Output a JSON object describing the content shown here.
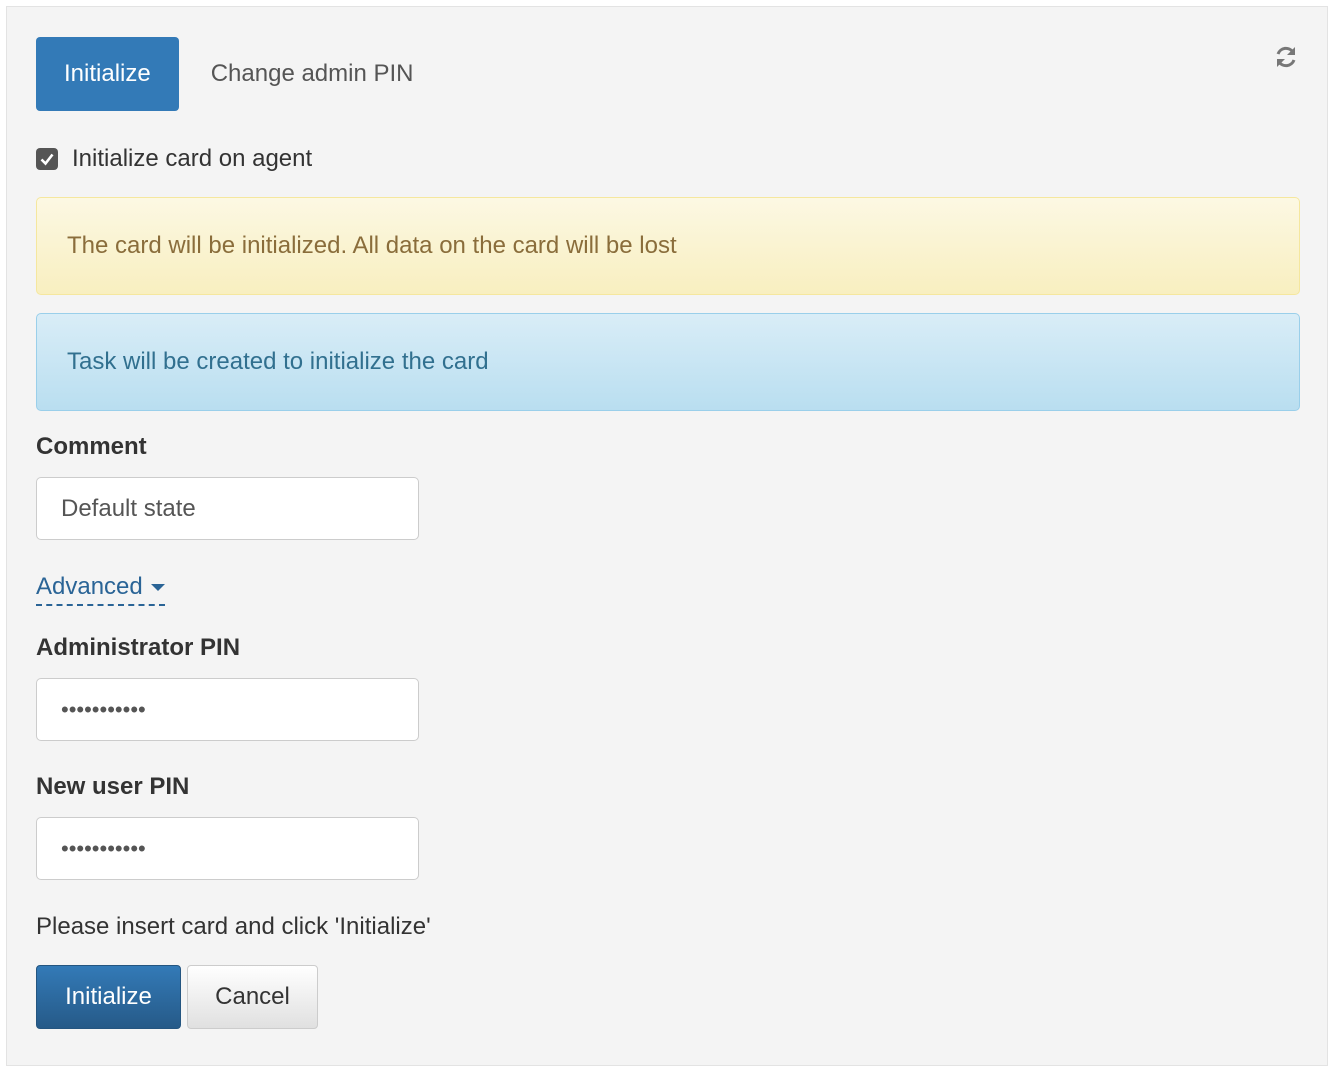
{
  "tabs": [
    {
      "label": "Initialize",
      "active": true
    },
    {
      "label": "Change admin PIN",
      "active": false
    }
  ],
  "refresh_icon": "refresh-icon",
  "checkbox": {
    "label": "Initialize card on agent",
    "checked": true
  },
  "alerts": {
    "warning": "The card will be initialized. All data on the card will be lost",
    "info": "Task will be created to initialize the card"
  },
  "comment": {
    "label": "Comment",
    "value": "Default state"
  },
  "advanced": {
    "label": "Advanced"
  },
  "admin_pin": {
    "label": "Administrator PIN",
    "value": "•••••••••••"
  },
  "user_pin": {
    "label": "New user PIN",
    "value": "•••••••••••"
  },
  "hint": "Please insert card and click 'Initialize'",
  "buttons": {
    "initialize": "Initialize",
    "cancel": "Cancel"
  },
  "colors": {
    "primary": "#337ab7",
    "warning_bg": "#fcf8e3",
    "info_bg": "#d9edf7"
  }
}
